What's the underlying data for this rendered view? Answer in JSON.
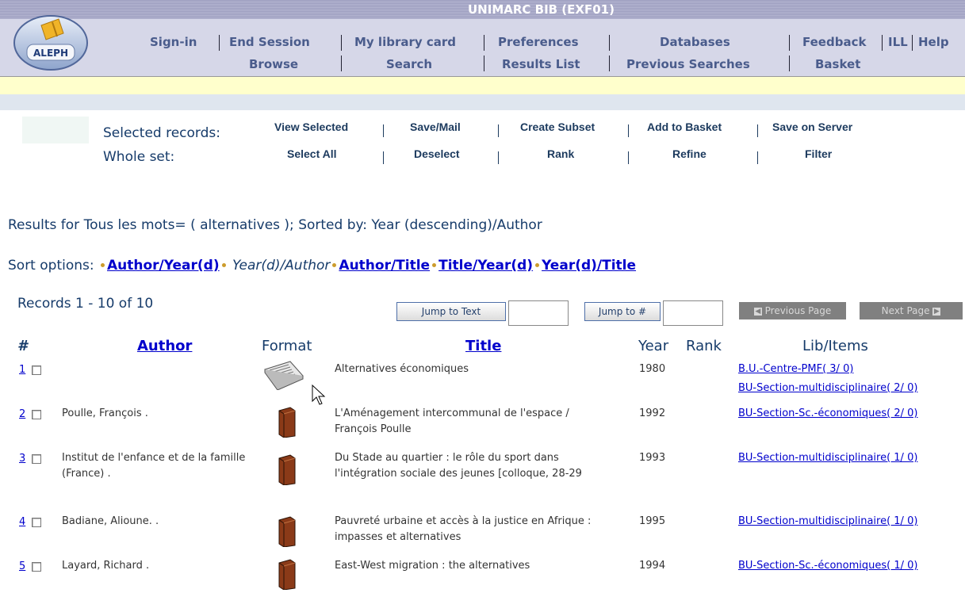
{
  "header": {
    "title": "UNIMARC BIB (EXF01)",
    "logo_text": "ALEPH",
    "nav_top": [
      "Sign-in",
      "End Session",
      "My library card",
      "Preferences",
      "Databases",
      "Feedback",
      "ILL",
      "Help"
    ],
    "nav_bottom": [
      "Browse",
      "Search",
      "Results List",
      "Previous Searches",
      "Basket"
    ]
  },
  "actions": {
    "selected_label": "Selected records:",
    "whole_label": "Whole set:",
    "selected": [
      "View Selected",
      "Save/Mail",
      "Create Subset",
      "Add to Basket",
      "Save on Server"
    ],
    "whole": [
      "Select All",
      "Deselect",
      "Rank",
      "Refine",
      "Filter"
    ]
  },
  "results_heading": "Results for Tous les mots= ( alternatives ); Sorted by: Year (descending)/Author",
  "sort": {
    "label": "Sort options:",
    "options": [
      "Author/Year(d)",
      "Year(d)/Author",
      "Author/Title",
      "Title/Year(d)",
      "Year(d)/Title"
    ],
    "current": "Year(d)/Author"
  },
  "records_count": "Records 1 - 10 of 10",
  "jump": {
    "text_button": "Jump to Text",
    "num_button": "Jump to #",
    "prev": "Previous Page",
    "next": "Next Page"
  },
  "columns": {
    "num": "#",
    "author": "Author",
    "format": "Format",
    "title": "Title",
    "year": "Year",
    "rank": "Rank",
    "lib": "Lib/Items"
  },
  "rows": [
    {
      "n": "1",
      "author": "",
      "format": "newspaper-icon",
      "title": "Alternatives économiques",
      "year": "1980",
      "lib": [
        "B.U.-Centre-PMF( 3/ 0)",
        "BU-Section-multidisciplinaire( 2/ 0)"
      ]
    },
    {
      "n": "2",
      "author": "Poulle, François .",
      "format": "book-icon",
      "title": "L'Aménagement intercommunal de l'espace / François Poulle",
      "year": "1992",
      "lib": [
        "BU-Section-Sc.-économiques( 2/ 0)"
      ]
    },
    {
      "n": "3",
      "author": "Institut de l'enfance et de la famille (France) .",
      "format": "book-icon",
      "title": "Du Stade au quartier : le rôle du sport dans l'intégration sociale des jeunes [colloque, 28-29",
      "year": "1993",
      "lib": [
        "BU-Section-multidisciplinaire( 1/ 0)"
      ]
    },
    {
      "n": "4",
      "author": "Badiane, Alioune. .",
      "format": "book-icon",
      "title": "Pauvreté urbaine et accès à la justice en Afrique : impasses et alternatives",
      "year": "1995",
      "lib": [
        "BU-Section-multidisciplinaire( 1/ 0)"
      ]
    },
    {
      "n": "5",
      "author": "Layard, Richard .",
      "format": "book-icon",
      "title": "East-West migration : the alternatives",
      "year": "1994",
      "lib": [
        "BU-Section-Sc.-économiques( 1/ 0)"
      ]
    }
  ]
}
